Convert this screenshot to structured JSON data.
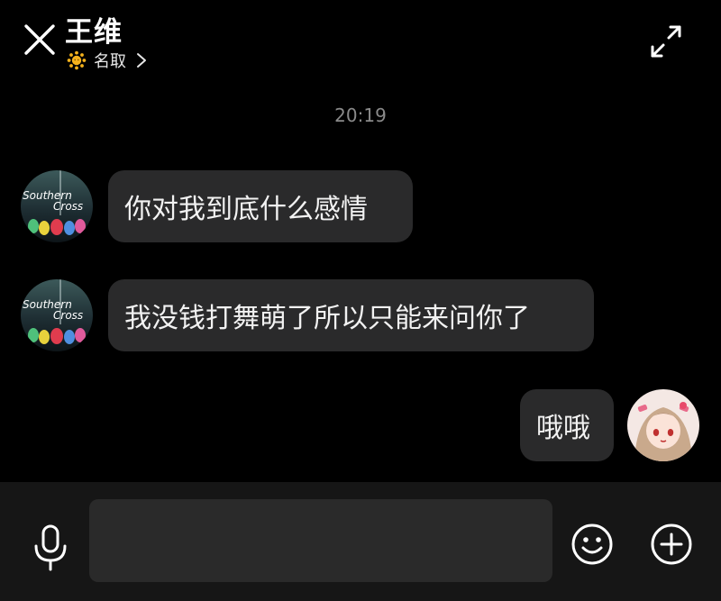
{
  "header": {
    "title": "王维",
    "subtitle": "名取",
    "close_icon": "close-icon",
    "expand_icon": "expand-icon",
    "badge_icon": "sun-icon"
  },
  "timestamp": "20:19",
  "messages": [
    {
      "sender": "other",
      "text": "你对我到底什么感情",
      "avatar_text_1": "Southern",
      "avatar_text_2": "Cross"
    },
    {
      "sender": "other",
      "text": "我没钱打舞萌了所以只能来问你了",
      "avatar_text_1": "Southern",
      "avatar_text_2": "Cross"
    },
    {
      "sender": "self",
      "text": "哦哦"
    }
  ],
  "input_bar": {
    "placeholder": "",
    "value": "",
    "mic_icon": "microphone-icon",
    "emoji_icon": "emoji-icon",
    "plus_icon": "plus-icon"
  },
  "colors": {
    "background": "#000000",
    "bubble": "#2a2a2b",
    "input_bar": "#161616",
    "input_field": "#2a2a2a",
    "timestamp": "#8a8a8a"
  }
}
